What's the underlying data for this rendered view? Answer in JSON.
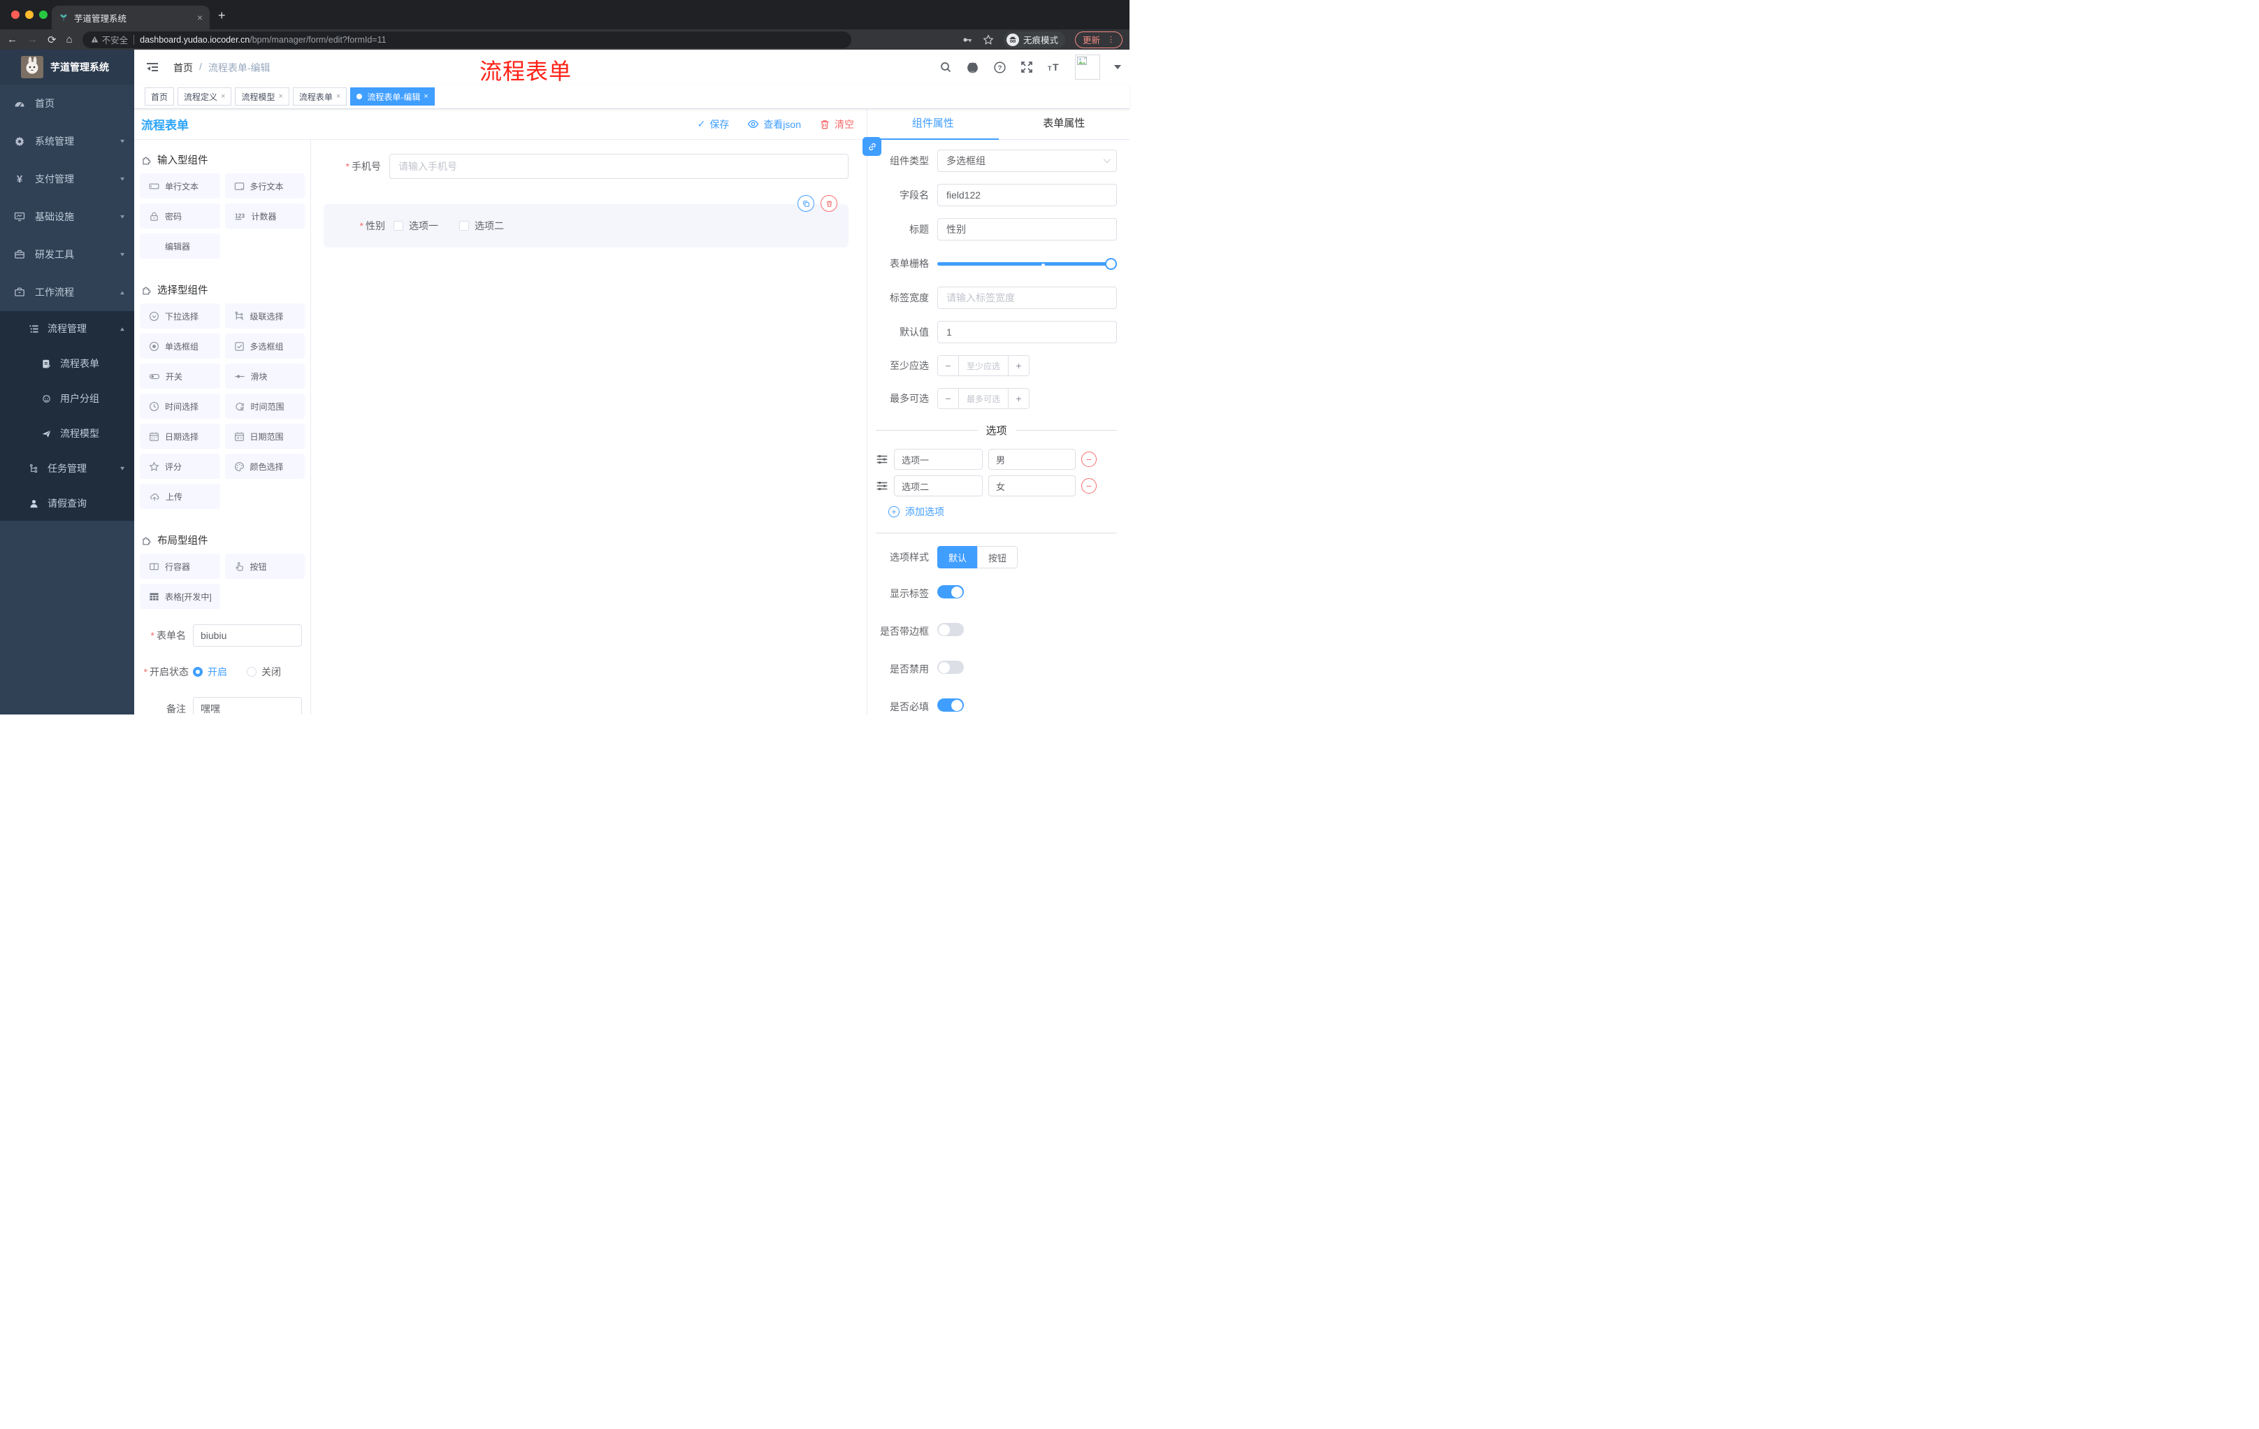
{
  "browser": {
    "tab": {
      "title": "芋道管理系统",
      "close": "×",
      "new_tab": "+"
    },
    "address": {
      "warning": "不安全",
      "host": "dashboard.yudao.iocoder.cn",
      "path": "/bpm/manager/form/edit?formId=11",
      "incognito": "无痕模式",
      "update": "更新",
      "menu_dots": "⋮"
    }
  },
  "sidebar": {
    "logo_title": "芋道管理系统",
    "items": [
      {
        "label": "首页",
        "icon": "dashboard-icon"
      },
      {
        "label": "系统管理",
        "icon": "gear-icon"
      },
      {
        "label": "支付管理",
        "icon": "yen-icon"
      },
      {
        "label": "基础设施",
        "icon": "monitor-icon"
      },
      {
        "label": "研发工具",
        "icon": "toolbox-icon"
      },
      {
        "label": "工作流程",
        "icon": "briefcase-icon"
      }
    ],
    "workflow": {
      "group": {
        "label": "流程管理",
        "icon": "list-icon"
      },
      "children": [
        {
          "label": "流程表单",
          "icon": "form-doc-icon"
        },
        {
          "label": "用户分组",
          "icon": "user-group-icon"
        },
        {
          "label": "流程模型",
          "icon": "send-icon"
        }
      ],
      "task": {
        "label": "任务管理",
        "icon": "tree-icon"
      },
      "leave": {
        "label": "请假查询",
        "icon": "person-icon"
      }
    }
  },
  "navbar": {
    "breadcrumb": {
      "home": "首页",
      "separator": "/",
      "current": "流程表单-编辑"
    },
    "annotation": "流程表单"
  },
  "tags": [
    {
      "label": "首页"
    },
    {
      "label": "流程定义"
    },
    {
      "label": "流程模型"
    },
    {
      "label": "流程表单"
    },
    {
      "label": "流程表单-编辑"
    }
  ],
  "editor": {
    "title": "流程表单",
    "toolbar": {
      "save": "保存",
      "view_json": "查看json",
      "clear": "清空"
    },
    "palette": {
      "sections": [
        {
          "title": "输入型组件",
          "items": [
            {
              "label": "单行文本",
              "icon": "input-icon"
            },
            {
              "label": "多行文本",
              "icon": "textarea-icon"
            },
            {
              "label": "密码",
              "icon": "lock-icon"
            },
            {
              "label": "计数器",
              "icon": "counter-icon"
            },
            {
              "label": "编辑器",
              "icon": "none"
            }
          ]
        },
        {
          "title": "选择型组件",
          "items": [
            {
              "label": "下拉选择",
              "icon": "select-icon"
            },
            {
              "label": "级联选择",
              "icon": "cascader-icon"
            },
            {
              "label": "单选框组",
              "icon": "radio-icon"
            },
            {
              "label": "多选框组",
              "icon": "checkbox-icon"
            },
            {
              "label": "开关",
              "icon": "switch-icon"
            },
            {
              "label": "滑块",
              "icon": "slider-icon"
            },
            {
              "label": "时间选择",
              "icon": "time-icon"
            },
            {
              "label": "时间范围",
              "icon": "time-range-icon"
            },
            {
              "label": "日期选择",
              "icon": "date-icon"
            },
            {
              "label": "日期范围",
              "icon": "date-range-icon"
            },
            {
              "label": "评分",
              "icon": "star-icon"
            },
            {
              "label": "颜色选择",
              "icon": "palette-icon"
            },
            {
              "label": "上传",
              "icon": "upload-icon"
            }
          ]
        },
        {
          "title": "布局型组件",
          "items": [
            {
              "label": "行容器",
              "icon": "row-icon"
            },
            {
              "label": "按钮",
              "icon": "hand-icon"
            },
            {
              "label": "表格[开发中]",
              "icon": "table-icon"
            }
          ]
        }
      ]
    },
    "form_meta": {
      "name_label": "表单名",
      "name_value": "biubiu",
      "status_label": "开启状态",
      "status_on": "开启",
      "status_off": "关闭",
      "remark_label": "备注",
      "remark_value": "嘿嘿"
    },
    "canvas": {
      "phone": {
        "label": "手机号",
        "placeholder": "请输入手机号"
      },
      "gender": {
        "label": "性别",
        "options": [
          "选项一",
          "选项二"
        ]
      }
    },
    "props": {
      "tabs": [
        "组件属性",
        "表单属性"
      ],
      "component_type_label": "组件类型",
      "component_type_value": "多选框组",
      "field_name_label": "字段名",
      "field_name_value": "field122",
      "title_label": "标题",
      "title_value": "性别",
      "grid_label": "表单栅格",
      "label_width_label": "标签宽度",
      "label_width_placeholder": "请输入标签宽度",
      "default_label": "默认值",
      "default_value": "1",
      "min_label": "至少应选",
      "min_placeholder": "至少应选",
      "max_label": "最多可选",
      "max_placeholder": "最多可选",
      "minus": "−",
      "plus": "+",
      "options_title": "选项",
      "options": [
        {
          "label": "选项一",
          "value": "男"
        },
        {
          "label": "选项二",
          "value": "女"
        }
      ],
      "add_option": "添加选项",
      "style_label": "选项样式",
      "style_default": "默认",
      "style_button": "按钮",
      "switches": [
        {
          "label": "显示标签",
          "on": true
        },
        {
          "label": "是否带边框",
          "on": false
        },
        {
          "label": "是否禁用",
          "on": false
        },
        {
          "label": "是否必填",
          "on": true
        }
      ]
    }
  },
  "colors": {
    "accent": "#409eff",
    "danger": "#f56c6c",
    "title_blue": "#2da4f8",
    "annotation_red": "#ff2116",
    "sidebar_bg": "#304156",
    "submenu_bg": "#1f2d3d",
    "tag_active": "#409eff",
    "chip_bg": "#f6f7ff",
    "selected_item_bg": "#f4f6fc"
  }
}
